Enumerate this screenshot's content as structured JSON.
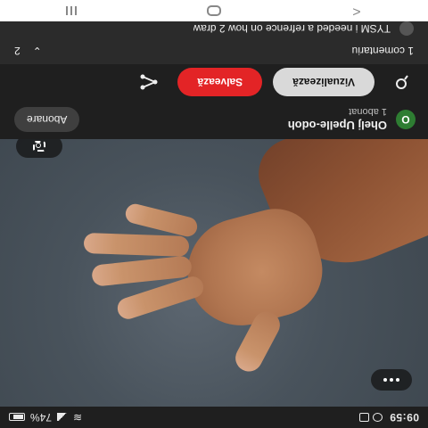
{
  "status_bar": {
    "time": "09:59",
    "battery_percent": "74%",
    "icons": [
      "wifi-icon",
      "signal-icon",
      "battery-icon",
      "notification-icon",
      "alarm-icon"
    ]
  },
  "media": {
    "description_icon": "hand-image",
    "more_icon": "more-icon",
    "expand_icon": "lens-icon"
  },
  "channel": {
    "avatar_letter": "O",
    "name": "Ohelj Upelle-odoh",
    "subscribers": "1 abonat",
    "subscribe_label": "Abonare"
  },
  "actions": {
    "view_label": "Vizualizează",
    "save_label": "Salvează",
    "icons": [
      "pin-icon",
      "share-icon"
    ]
  },
  "comments": {
    "header": "1 comentariu",
    "count": "2",
    "first_comment": "TYSM i needed a refrence on how 2 draw"
  },
  "navbar": {
    "icons": [
      "recent-apps-icon",
      "home-icon",
      "back-icon"
    ]
  },
  "colors": {
    "background": "#1f1f1f",
    "save_red": "#e32426",
    "avatar_green": "#2e7d32",
    "pill_gray": "#d9d9d9"
  }
}
